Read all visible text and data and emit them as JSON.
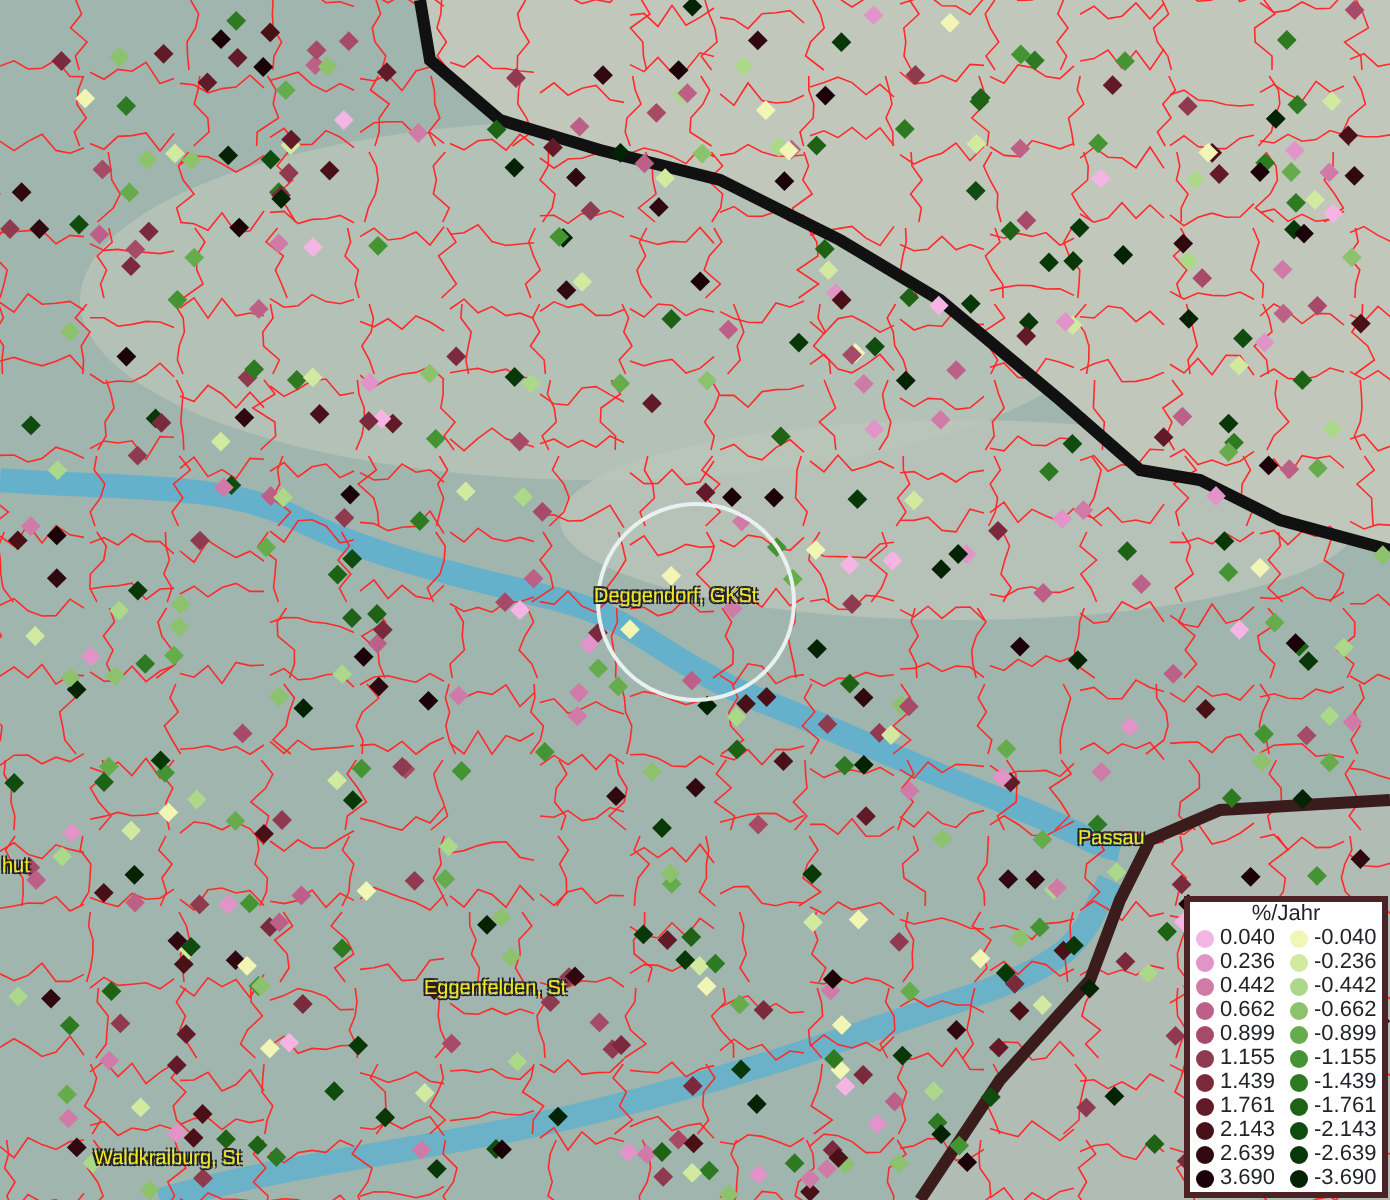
{
  "map": {
    "labels": [
      {
        "text": "Deggendorf, GKSt"
      },
      {
        "text": "Passau"
      },
      {
        "text": "hut"
      },
      {
        "text": "Eggenfelden, St"
      },
      {
        "text": "Waldkraiburg, St"
      }
    ]
  },
  "legend": {
    "title": "%/Jahr",
    "rows": [
      {
        "positive": {
          "label": "0.040",
          "color": "#f4b4e4"
        },
        "negative": {
          "label": "-0.040",
          "color": "#f2f6b4"
        }
      },
      {
        "positive": {
          "label": "0.236",
          "color": "#e294c8"
        },
        "negative": {
          "label": "-0.236",
          "color": "#d2eaa0"
        }
      },
      {
        "positive": {
          "label": "0.442",
          "color": "#d07aa8"
        },
        "negative": {
          "label": "-0.442",
          "color": "#acd88a"
        }
      },
      {
        "positive": {
          "label": "0.662",
          "color": "#bc6088"
        },
        "negative": {
          "label": "-0.662",
          "color": "#8cc26c"
        }
      },
      {
        "positive": {
          "label": "0.899",
          "color": "#a64a68"
        },
        "negative": {
          "label": "-0.899",
          "color": "#66ac4c"
        }
      },
      {
        "positive": {
          "label": "1.155",
          "color": "#903a50"
        },
        "negative": {
          "label": "-1.155",
          "color": "#449434"
        }
      },
      {
        "positive": {
          "label": "1.439",
          "color": "#7a2a3c"
        },
        "negative": {
          "label": "-1.439",
          "color": "#2e7a22"
        }
      },
      {
        "positive": {
          "label": "1.761",
          "color": "#621a28"
        },
        "negative": {
          "label": "-1.761",
          "color": "#1e6216"
        }
      },
      {
        "positive": {
          "label": "2.143",
          "color": "#4a1018"
        },
        "negative": {
          "label": "-2.143",
          "color": "#104c10"
        }
      },
      {
        "positive": {
          "label": "2.639",
          "color": "#300810"
        },
        "negative": {
          "label": "-2.639",
          "color": "#083808"
        }
      },
      {
        "positive": {
          "label": "3.690",
          "color": "#1a0208"
        },
        "negative": {
          "label": "-3.690",
          "color": "#042204"
        }
      }
    ]
  }
}
